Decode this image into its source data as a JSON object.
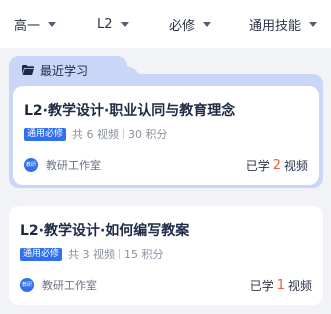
{
  "filters": [
    {
      "label": "高一"
    },
    {
      "label": "L2"
    },
    {
      "label": "必修"
    },
    {
      "label": "通用技能"
    }
  ],
  "recent": {
    "section_label": "最近学习",
    "course": {
      "title": "L2·教学设计·职业认同与教育理念",
      "tag": "通用必修",
      "video_count": "共 6 视频",
      "points": "30 积分",
      "publisher_logo": "教研",
      "publisher": "教研工作室",
      "progress_prefix": "已学",
      "progress_count": "2",
      "progress_suffix": "视频"
    }
  },
  "courses": [
    {
      "title": "L2·教学设计·如何编写教案",
      "tag": "通用必修",
      "video_count": "共 3 视频",
      "points": "15 积分",
      "publisher_logo": "教研",
      "publisher": "教研工作室",
      "progress_prefix": "已学",
      "progress_count": "1",
      "progress_suffix": "视频"
    }
  ],
  "colors": {
    "accent": "#2f6ff0",
    "folder": "#c9d6f7",
    "progress_highlight": "#f05a3c"
  }
}
